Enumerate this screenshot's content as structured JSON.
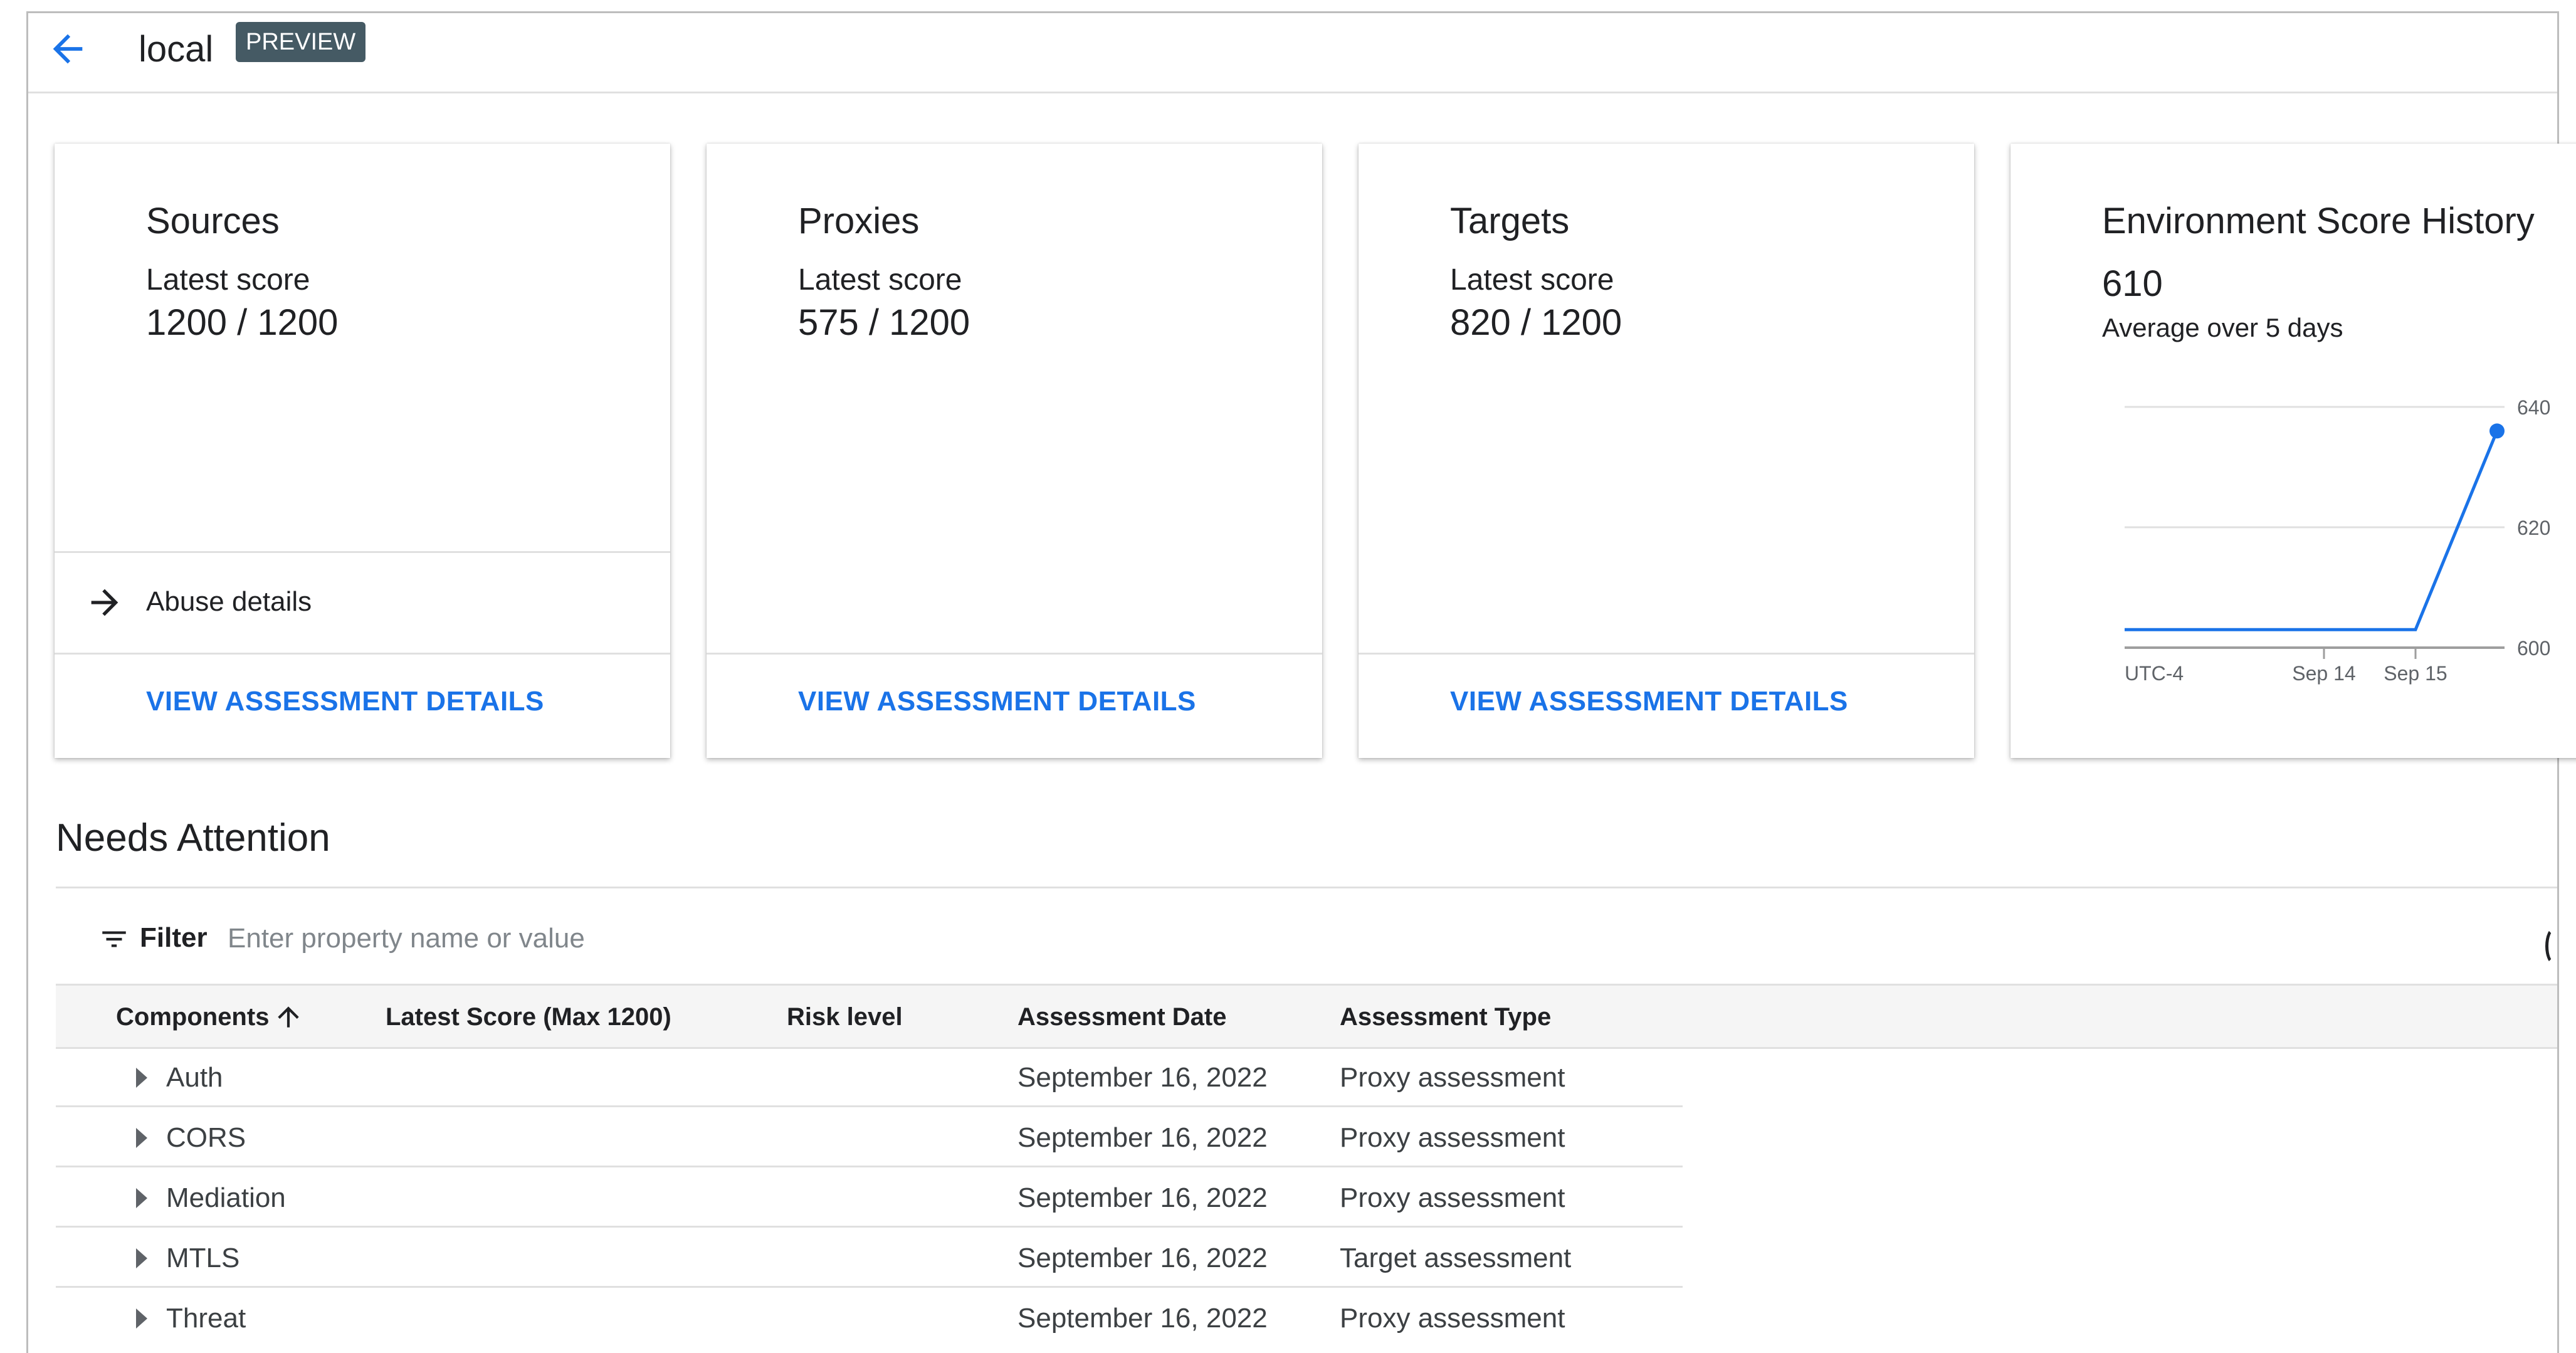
{
  "header": {
    "title": "local",
    "badge": "PREVIEW"
  },
  "cards": [
    {
      "title": "Sources",
      "label": "Latest score",
      "score": "1200 / 1200",
      "abuse_label": "Abuse details",
      "link": "VIEW ASSESSMENT DETAILS"
    },
    {
      "title": "Proxies",
      "label": "Latest score",
      "score": "575 / 1200",
      "link": "VIEW ASSESSMENT DETAILS"
    },
    {
      "title": "Targets",
      "label": "Latest score",
      "score": "820 / 1200",
      "link": "VIEW ASSESSMENT DETAILS"
    }
  ],
  "history": {
    "title": "Environment Score History",
    "value": "610",
    "subtitle": "Average over 5 days"
  },
  "chart_data": {
    "type": "line",
    "title": "Environment Score History",
    "x_ticks": [
      "UTC-4",
      "Sep 14",
      "Sep 15"
    ],
    "y_ticks": [
      600,
      620,
      640
    ],
    "ylim": [
      600,
      640
    ],
    "series": [
      {
        "points": [
          {
            "x": "UTC-4",
            "y": 603
          },
          {
            "x": "Sep 14",
            "y": 603
          },
          {
            "x": "Sep 15",
            "y": 603
          },
          {
            "x": "Sep 16",
            "y": 636
          }
        ]
      }
    ],
    "grid": true,
    "line_color": "#1a73e8"
  },
  "needs_attention": {
    "title": "Needs Attention",
    "filter_label": "Filter",
    "filter_placeholder": "Enter property name or value",
    "columns": [
      "Components",
      "Latest Score (Max 1200)",
      "Risk level",
      "Assessment Date",
      "Assessment Type"
    ],
    "rows": [
      {
        "component": "Auth",
        "score": "",
        "risk": "",
        "date": "September 16, 2022",
        "type": "Proxy assessment"
      },
      {
        "component": "CORS",
        "score": "",
        "risk": "",
        "date": "September 16, 2022",
        "type": "Proxy assessment"
      },
      {
        "component": "Mediation",
        "score": "",
        "risk": "",
        "date": "September 16, 2022",
        "type": "Proxy assessment"
      },
      {
        "component": "MTLS",
        "score": "",
        "risk": "",
        "date": "September 16, 2022",
        "type": "Target assessment"
      },
      {
        "component": "Threat",
        "score": "",
        "risk": "",
        "date": "September 16, 2022",
        "type": "Proxy assessment"
      }
    ]
  }
}
